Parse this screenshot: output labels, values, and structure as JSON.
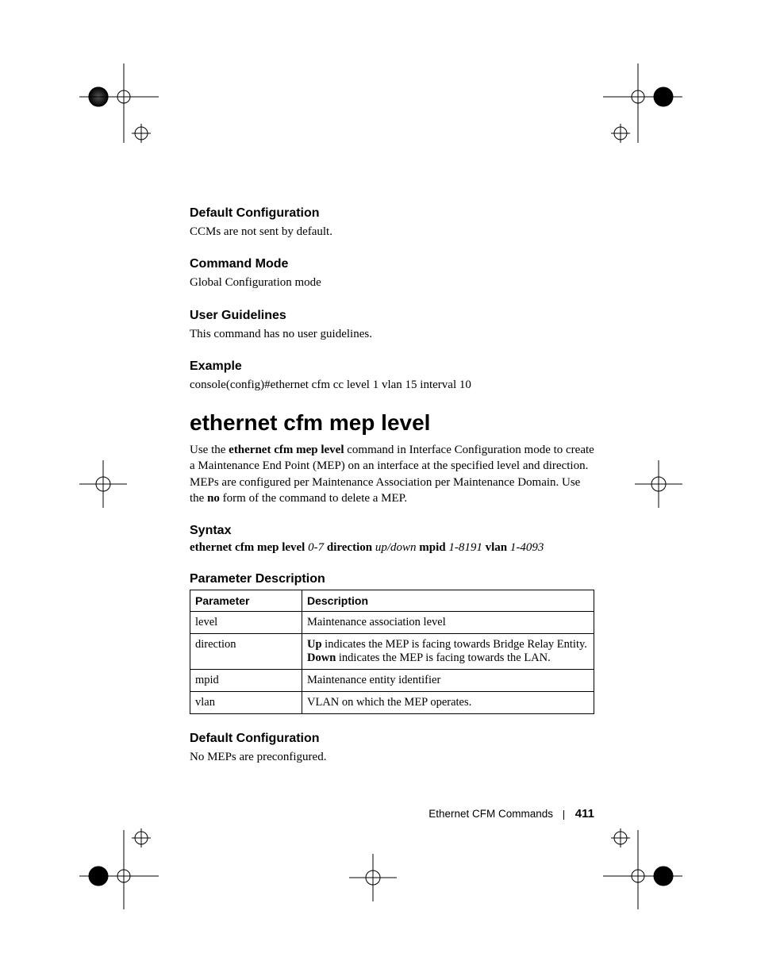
{
  "sections": {
    "default_cfg_1": {
      "head": "Default Configuration",
      "body": "CCMs are not sent by default."
    },
    "command_mode": {
      "head": "Command Mode",
      "body": "Global Configuration mode"
    },
    "user_guidelines": {
      "head": "User Guidelines",
      "body": "This command has no user guidelines."
    },
    "example": {
      "head": "Example",
      "body": "console(config)#ethernet cfm cc level 1 vlan 15 interval 10"
    },
    "cmd_title": "ethernet cfm mep level",
    "cmd_intro_html": "Use the <b>ethernet cfm mep level</b> command in Interface Configuration mode to create a Maintenance End Point (MEP) on an interface at the specified level and direction. MEPs are configured per Maintenance Association per Maintenance Domain. Use the <b>no</b> form of the command to delete a MEP.",
    "syntax_head": "Syntax",
    "syntax_html": "<span class=\"kw\">ethernet cfm mep level</span> <span class=\"arg\">0-7</span> <span class=\"kw\">direction</span> <span class=\"arg\">up/down</span> <span class=\"kw\">mpid</span> <span class=\"arg\">1-8191</span> <span class=\"kw\">vlan</span> <span class=\"arg\">1-4093</span>",
    "param_desc_head": "Parameter Description",
    "param_table": {
      "headers": [
        "Parameter",
        "Description"
      ],
      "rows": [
        {
          "p": "level",
          "d": "Maintenance association level"
        },
        {
          "p": "direction",
          "d": "<b>Up</b> indicates the MEP is facing towards Bridge Relay Entity. <b>Down</b> indicates the MEP is facing towards the LAN."
        },
        {
          "p": "mpid",
          "d": "Maintenance entity identifier"
        },
        {
          "p": "vlan",
          "d": "VLAN on which the MEP operates."
        }
      ]
    },
    "default_cfg_2": {
      "head": "Default Configuration",
      "body": "No MEPs are preconfigured."
    }
  },
  "footer": {
    "chapter": "Ethernet CFM Commands",
    "page": "411"
  }
}
